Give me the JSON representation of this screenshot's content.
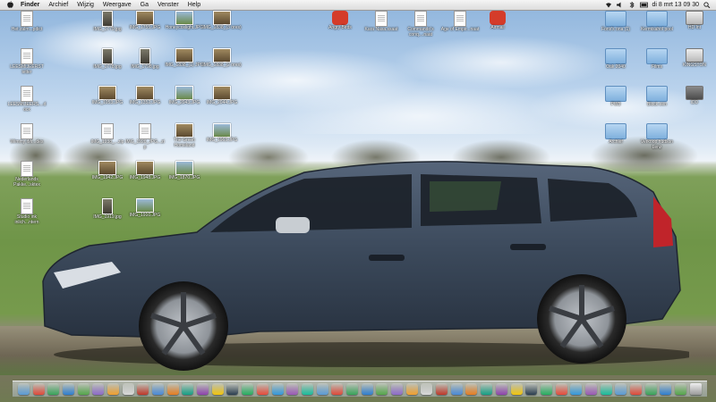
{
  "menubar": {
    "apple_icon": "apple-icon",
    "app_name": "Finder",
    "menus": [
      "Archief",
      "Wijzig",
      "Weergave",
      "Ga",
      "Venster",
      "Help"
    ],
    "clock": "di 8 mrt  13 09 30",
    "status_icons": [
      "wifi-icon",
      "volume-icon",
      "bluetooth-icon",
      "battery-icon",
      "spotlight-icon"
    ]
  },
  "desktop_icons": [
    {
      "label": "Het zalm...pdict",
      "kind": "doc"
    },
    {
      "label": "IMG_1779.jpg",
      "kind": "tall"
    },
    {
      "label": "IMG_1755.JPG",
      "kind": "photo"
    },
    {
      "label": "Honeycoslight.JPG",
      "kind": "photo"
    },
    {
      "label": "IMG_1838_(3 ores)",
      "kind": "photo"
    },
    {
      "label": "Angry Birds",
      "kind": "app"
    },
    {
      "label": "Kara Nasa.ssaat",
      "kind": "doc"
    },
    {
      "label": "Commando's conq....naat",
      "kind": "doc"
    },
    {
      "label": "Age of Empir...naat",
      "kind": "doc"
    },
    {
      "label": "Airmail",
      "kind": "app"
    },
    {
      "label": "Fons's ona (1)",
      "kind": "folder"
    },
    {
      "label": "Kermisahol pool",
      "kind": "folder"
    },
    {
      "label": "HD Int",
      "kind": "drive"
    },
    {
      "label": "LEESMIJEERST letter",
      "kind": "doc"
    },
    {
      "label": "IMG_1778.jpg",
      "kind": "tall"
    },
    {
      "label": "IMG_1798.jpg",
      "kind": "tall"
    },
    {
      "label": "IMG_1838_(1) JPG",
      "kind": "photo"
    },
    {
      "label": "IMG_1838_(2 ores)",
      "kind": "photo"
    },
    {
      "label": "Oak 2040",
      "kind": "folder"
    },
    {
      "label": "Films",
      "kind": "folder"
    },
    {
      "label": "KINGSTON",
      "kind": "drive"
    },
    {
      "label": "LEESMIJEERS....docx",
      "kind": "doc"
    },
    {
      "label": "IMG_1053.JPG",
      "kind": "photo"
    },
    {
      "label": "IMG_1352.JPG",
      "kind": "photo"
    },
    {
      "label": "IMG_2043.JPG",
      "kind": "photo"
    },
    {
      "label": "IMG_2044.JPG",
      "kind": "photo"
    },
    {
      "label": "PW3",
      "kind": "folder"
    },
    {
      "label": "Block een",
      "kind": "folder"
    },
    {
      "label": "iDD",
      "kind": "drive"
    },
    {
      "label": "Wimmy iMr...des",
      "kind": "doc"
    },
    {
      "label": "IMG_1938_...zip",
      "kind": "doc"
    },
    {
      "label": "IMG_1920_JPG...zip",
      "kind": "doc"
    },
    {
      "label": "The Green Homeland",
      "kind": "photo"
    },
    {
      "label": "IMG_1963.JPG",
      "kind": "photo"
    },
    {
      "label": "Archief",
      "kind": "folder"
    },
    {
      "label": "Verkoop hudson Lenz",
      "kind": "folder"
    },
    {
      "label": "Nederlands Pakke...sktex",
      "kind": "doc"
    },
    {
      "label": "IMG_1942.JPG",
      "kind": "photo"
    },
    {
      "label": "IMG_1948.JPG",
      "kind": "photo"
    },
    {
      "label": "IMG_1870.JPG",
      "kind": "photo"
    },
    {
      "label": "Studio ink inlich...ntern",
      "kind": "doc"
    },
    {
      "label": "IMG_1919.jpg",
      "kind": "tall"
    },
    {
      "label": "IMG_1910.JPG",
      "kind": "photo"
    }
  ],
  "colors": {
    "car_body": "#3c4a5c",
    "menubar": "#e8e8e8",
    "label_text": "#ffffff"
  },
  "dock": {
    "items": [
      "finder-icon",
      "chrome-icon",
      "network-icon",
      "safari-icon",
      "utorrent-icon",
      "itunes-icon",
      "mail-icon",
      "ical-icon",
      "address-icon",
      "preview-icon",
      "photos-icon",
      "ibooks-icon",
      "app-icon",
      "stickies-icon",
      "app-icon",
      "app-icon",
      "app-icon",
      "app-icon",
      "app-icon",
      "app-icon",
      "app-icon",
      "app-icon",
      "app-icon",
      "app-icon",
      "vlc-icon",
      "app-icon",
      "app-icon",
      "app-icon",
      "app-icon",
      "app-icon",
      "app-icon",
      "app-icon",
      "app-icon",
      "app-icon",
      "app-icon",
      "app-icon",
      "app-icon",
      "app-icon",
      "app-icon",
      "app-icon",
      "app-icon",
      "skype-icon",
      "app-icon",
      "app-icon",
      "app-icon",
      "trash-icon"
    ]
  }
}
